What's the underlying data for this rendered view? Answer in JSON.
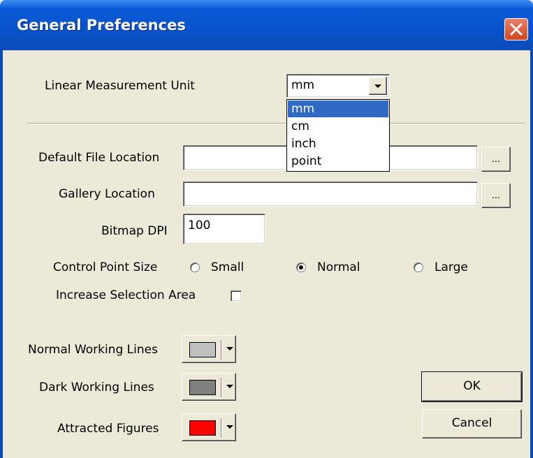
{
  "window": {
    "title": "General Preferences",
    "close_label": "✕"
  },
  "linear_unit": {
    "label": "Linear Measurement Unit",
    "selected": "mm",
    "options": [
      "mm",
      "cm",
      "inch",
      "point"
    ],
    "highlighted": "mm"
  },
  "default_file_location": {
    "label": "Default File Location",
    "value": "",
    "browse_label": "..."
  },
  "gallery_location": {
    "label": "Gallery Location",
    "value": "",
    "browse_label": "..."
  },
  "bitmap_dpi": {
    "label": "Bitmap DPI",
    "value": "100"
  },
  "control_point_size": {
    "label": "Control Point Size",
    "options": [
      "Small",
      "Normal",
      "Large"
    ],
    "selected": "Normal"
  },
  "increase_selection_area": {
    "label": "Increase Selection Area",
    "checked": false
  },
  "colors": {
    "normal_working_lines": {
      "label": "Normal Working Lines",
      "color": "#C0C0C0"
    },
    "dark_working_lines": {
      "label": "Dark Working Lines",
      "color": "#808080"
    },
    "attracted_figures": {
      "label": "Attracted Figures",
      "color": "#FF0000"
    }
  },
  "buttons": {
    "ok": "OK",
    "cancel": "Cancel"
  }
}
